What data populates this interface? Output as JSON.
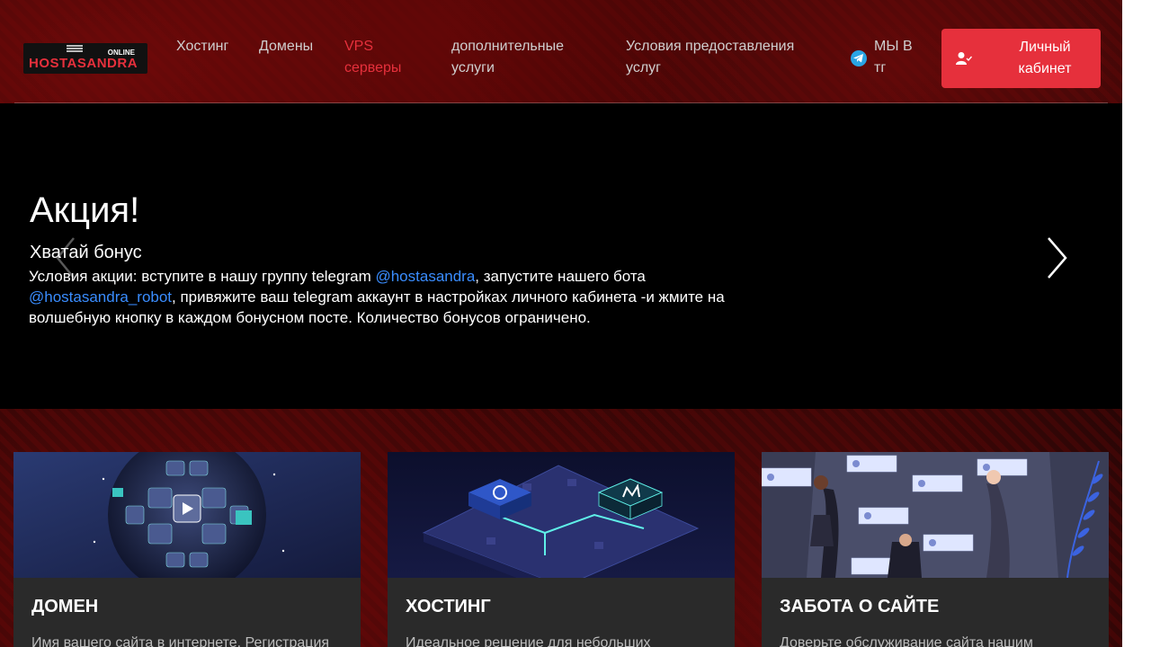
{
  "logo": {
    "online": "ONLINE",
    "main": "HOSTASANDRA"
  },
  "nav": [
    {
      "label": "Хостинг"
    },
    {
      "label": "Домены"
    },
    {
      "label": "VPS серверы"
    },
    {
      "label": "дополнительные услуги"
    },
    {
      "label": "Условия предоставления услуг"
    }
  ],
  "telegram": {
    "label": "МЫ В тг",
    "icon": "telegram-icon"
  },
  "cabinet": {
    "label": "Личный кабинет",
    "icon": "user-check-icon"
  },
  "hero": {
    "title": "Акция!",
    "subtitle": "Хватай бонус",
    "text_1": "Условия акции: вступите в нашу группу telegram ",
    "link_1": "@hostasandra",
    "text_2": ", запустите нашего бота ",
    "link_2": "@hostasandra_robot",
    "text_3": ", привяжите ваш telegram аккаунт в настройках личного кабинета -и жмите на волшебную кнопку в каждом бонусном посте. Количество бонусов ограничено."
  },
  "cards": [
    {
      "title": "ДОМЕН",
      "text": "Имя вашего сайта в интернете. Регистрация"
    },
    {
      "title": "ХОСТИНГ",
      "text": "Идеальное решение для небольших"
    },
    {
      "title": "ЗАБОТА О САЙТЕ",
      "text": "Доверьте обслуживание сайта нашим"
    }
  ],
  "colors": {
    "accent": "#e6303c",
    "link": "#3a8dff",
    "card_bg": "#2a2a2a"
  }
}
